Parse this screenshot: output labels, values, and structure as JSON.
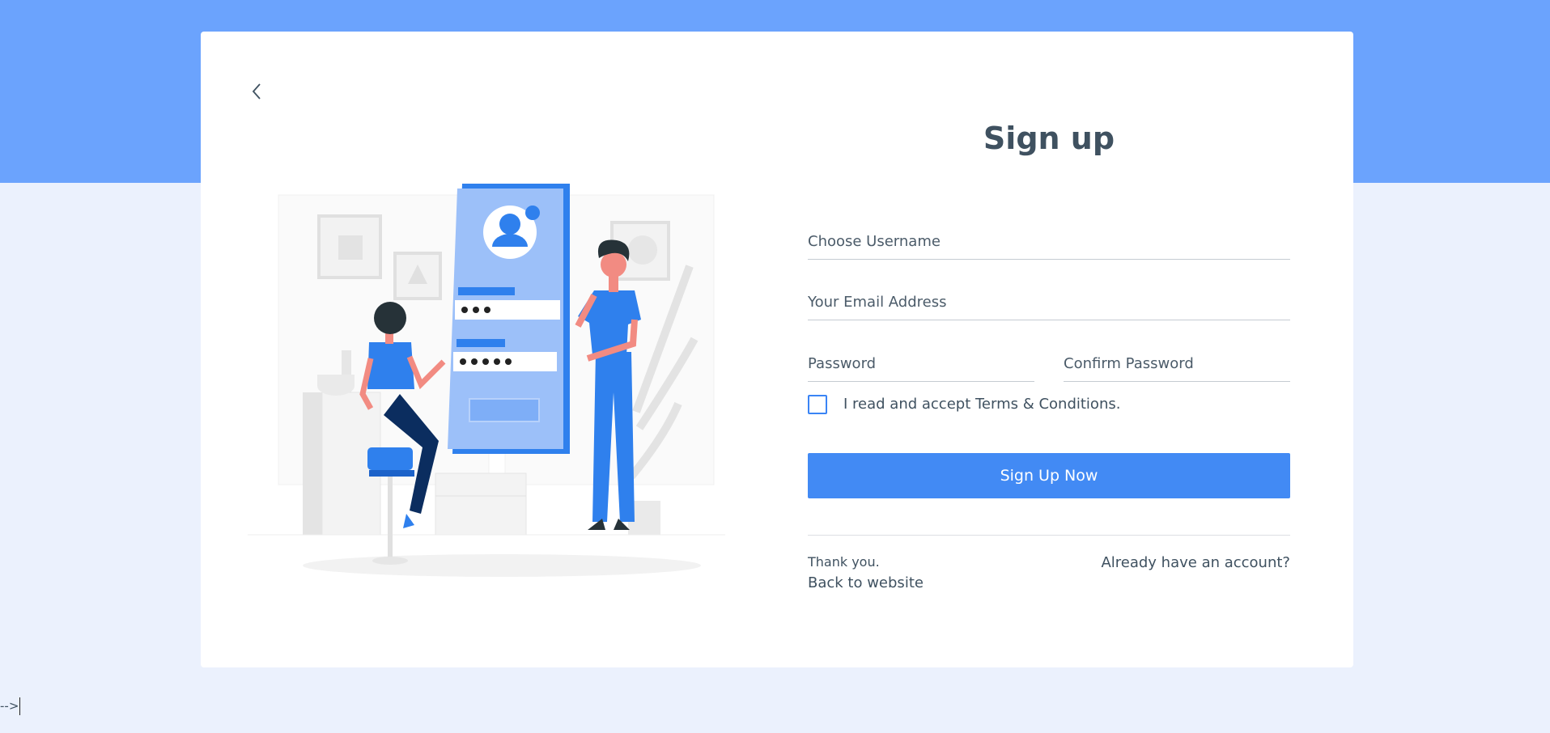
{
  "colors": {
    "page_bg": "#ebf1fd",
    "top_band": "#6ba3fd",
    "card_bg": "#ffffff",
    "accent": "#428af4",
    "text": "#3f5160"
  },
  "icons": {
    "back": "chevron-left-icon"
  },
  "form": {
    "title": "Sign up",
    "username_placeholder": "Choose Username",
    "email_placeholder": "Your Email Address",
    "password_placeholder": "Password",
    "confirm_placeholder": "Confirm Password",
    "terms_label": "I read and accept Terms & Conditions.",
    "terms_checked": false,
    "submit_label": "Sign Up Now"
  },
  "footer": {
    "thanks": "Thank you.",
    "back_to_website": "Back to website",
    "login_link": "Already have an account?"
  },
  "stray_text": "-->"
}
